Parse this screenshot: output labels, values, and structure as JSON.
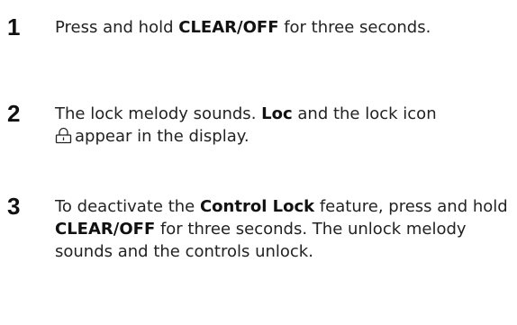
{
  "steps": [
    {
      "number": "1",
      "parts": {
        "t1": "Press and hold ",
        "b1": "CLEAR/OFF",
        "t2": " for three seconds."
      }
    },
    {
      "number": "2",
      "parts": {
        "t1": "The lock melody sounds. ",
        "b1": "Loc",
        "t2": " and the lock icon",
        "icon": "lock-icon",
        "t3": "appear in the display."
      }
    },
    {
      "number": "3",
      "parts": {
        "t1": "To deactivate the ",
        "b1": "Control Lock",
        "t2": " feature, press and hold ",
        "b2": "CLEAR/OFF",
        "t3": " for three seconds. The unlock melody sounds and the controls unlock."
      }
    }
  ]
}
